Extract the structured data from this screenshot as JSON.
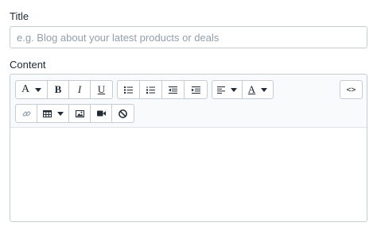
{
  "title_field": {
    "label": "Title",
    "value": "",
    "placeholder": "e.g. Blog about your latest products or deals"
  },
  "content_field": {
    "label": "Content",
    "value": ""
  },
  "toolbar": {
    "font_button": {
      "glyph": "A",
      "icon": "font-family-icon"
    },
    "bold": {
      "glyph": "B",
      "icon": "bold-icon"
    },
    "italic": {
      "glyph": "I",
      "icon": "italic-icon"
    },
    "underline": {
      "glyph": "U",
      "icon": "underline-icon"
    },
    "bulleted_list": {
      "icon": "bulleted-list-icon"
    },
    "numbered_list": {
      "icon": "numbered-list-icon"
    },
    "outdent": {
      "icon": "outdent-icon"
    },
    "indent": {
      "icon": "indent-icon"
    },
    "align": {
      "icon": "align-left-icon"
    },
    "text_color": {
      "glyph": "A",
      "icon": "text-color-icon"
    },
    "source_code": {
      "glyph": "<>",
      "icon": "code-icon"
    },
    "link": {
      "icon": "link-icon"
    },
    "table": {
      "icon": "table-icon"
    },
    "image": {
      "icon": "image-icon"
    },
    "video": {
      "icon": "video-icon"
    },
    "clear_formatting": {
      "icon": "clear-formatting-icon"
    }
  },
  "colors": {
    "border": "#c4cdd5",
    "toolbar_bg": "#f9fafb",
    "text": "#212b36",
    "placeholder": "#919eab",
    "link_icon_disabled": "#919eab"
  }
}
